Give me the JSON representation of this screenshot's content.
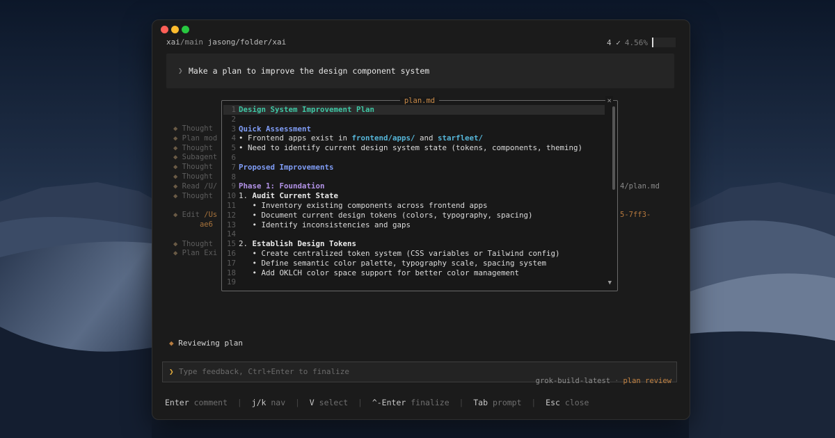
{
  "window": {
    "traffic_lights": [
      {
        "name": "close",
        "color": "#ff5f57"
      },
      {
        "name": "minimize",
        "color": "#febc2e"
      },
      {
        "name": "maximize",
        "color": "#28c840"
      }
    ]
  },
  "status": {
    "repo": "xai",
    "branch": "/main",
    "path": "jasong/folder/xai",
    "check_count": "4 ✓",
    "percent": "4.56%"
  },
  "prompt": {
    "chevron": "❯",
    "text": "Make a plan to improve the design component system"
  },
  "log": [
    {
      "icon": "◆",
      "label": "Thought"
    },
    {
      "icon": "◆",
      "label": "Plan mod"
    },
    {
      "icon": "◆",
      "label": "Thought"
    },
    {
      "icon": "◆",
      "label": "Subagent"
    },
    {
      "icon": "◆",
      "label": "Thought"
    },
    {
      "icon": "◆",
      "label": "Thought"
    },
    {
      "icon": "◆",
      "label": "Read /U/"
    },
    {
      "icon": "◆",
      "label": "Thought"
    },
    {
      "icon": "",
      "label": ""
    },
    {
      "icon": "◆",
      "label": "Edit ",
      "path": "/Us"
    },
    {
      "icon": "",
      "label": "      ",
      "path": "ae6"
    },
    {
      "icon": "",
      "label": ""
    },
    {
      "icon": "◆",
      "label": "Thought"
    },
    {
      "icon": "◆",
      "label": "Plan Exi"
    }
  ],
  "log_tails": {
    "read_tail": "4/plan.md",
    "edit_tail": "5-7ff3-"
  },
  "plan": {
    "filename": "plan.md",
    "close": "×",
    "lines": [
      {
        "n": "1",
        "segments": [
          {
            "t": "Design System Improvement Plan",
            "c": "teal"
          }
        ],
        "active": true
      },
      {
        "n": "2",
        "segments": []
      },
      {
        "n": "3",
        "segments": [
          {
            "t": "Quick Assessment",
            "c": "blue"
          }
        ]
      },
      {
        "n": "4",
        "segments": [
          {
            "t": "• Frontend apps exist in ",
            "c": ""
          },
          {
            "t": "frontend/apps/",
            "c": "link"
          },
          {
            "t": " and ",
            "c": ""
          },
          {
            "t": "starfleet/",
            "c": "link"
          }
        ]
      },
      {
        "n": "5",
        "segments": [
          {
            "t": "• Need to identify current design system state (tokens, components, theming)",
            "c": ""
          }
        ]
      },
      {
        "n": "6",
        "segments": []
      },
      {
        "n": "7",
        "segments": [
          {
            "t": "Proposed Improvements",
            "c": "blue"
          }
        ]
      },
      {
        "n": "8",
        "segments": []
      },
      {
        "n": "9",
        "segments": [
          {
            "t": "Phase 1: Foundation",
            "c": "purple"
          }
        ]
      },
      {
        "n": "10",
        "segments": [
          {
            "t": "1. ",
            "c": ""
          },
          {
            "t": "Audit Current State",
            "c": "whiteb"
          }
        ]
      },
      {
        "n": "11",
        "segments": [
          {
            "t": "   • Inventory existing components across frontend apps",
            "c": ""
          }
        ]
      },
      {
        "n": "12",
        "segments": [
          {
            "t": "   • Document current design tokens (colors, typography, spacing)",
            "c": ""
          }
        ]
      },
      {
        "n": "13",
        "segments": [
          {
            "t": "   • Identify inconsistencies and gaps",
            "c": ""
          }
        ]
      },
      {
        "n": "14",
        "segments": []
      },
      {
        "n": "15",
        "segments": [
          {
            "t": "2. ",
            "c": ""
          },
          {
            "t": "Establish Design Tokens",
            "c": "whiteb"
          }
        ]
      },
      {
        "n": "16",
        "segments": [
          {
            "t": "   • Create centralized token system (CSS variables or Tailwind config)",
            "c": ""
          }
        ]
      },
      {
        "n": "17",
        "segments": [
          {
            "t": "   • Define semantic color palette, typography scale, spacing system",
            "c": ""
          }
        ]
      },
      {
        "n": "18",
        "segments": [
          {
            "t": "   • Add OKLCH color space support for better color management",
            "c": ""
          }
        ]
      },
      {
        "n": "19",
        "segments": []
      }
    ],
    "scroll_down": "▼"
  },
  "reviewing": {
    "icon": "◆",
    "text": "Reviewing plan"
  },
  "feedback": {
    "caret": "❯",
    "placeholder": "Type feedback, Ctrl+Enter to finalize"
  },
  "model": {
    "name": "grok-build-latest",
    "sep": "·",
    "mode": "plan review"
  },
  "hints": [
    {
      "key": "Enter",
      "label": "comment"
    },
    {
      "key": "j/k",
      "label": "nav"
    },
    {
      "key": "V",
      "label": "select"
    },
    {
      "key": "^-Enter",
      "label": "finalize"
    },
    {
      "key": "Tab",
      "label": "prompt"
    },
    {
      "key": "Esc",
      "label": "close"
    }
  ]
}
